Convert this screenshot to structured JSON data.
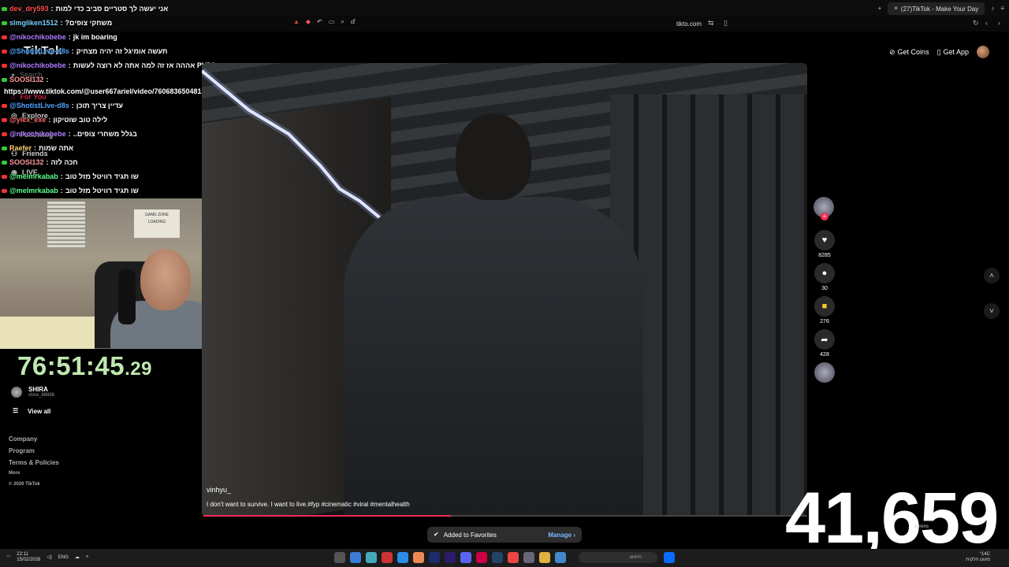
{
  "browser": {
    "tab_title": "(27)TikTok - Make Your Day",
    "domain": "tikto.com"
  },
  "tiktok": {
    "logo": "TikTok",
    "get_coins": "Get Coins",
    "get_app": "Get App",
    "sidebar": {
      "search": "Search",
      "for_you": "For You",
      "explore": "Explore",
      "following": "Following",
      "friends": "Friends",
      "live": "LIVE"
    },
    "profile_name": "SHIRA",
    "profile_handle": "shira_88888",
    "view_all": "View all",
    "footer": [
      "Company",
      "Program",
      "Terms & Policies",
      "More",
      "© 2026 TikTok"
    ],
    "video": {
      "author": "vinhyu_",
      "caption": "I don't want to survive. I want to live.#fyp #cinematic #viral #mentalhealth",
      "progress_fraction": 0.41
    },
    "rail": {
      "likes": "8285",
      "comments": "30",
      "saves": "276",
      "shares": "428"
    },
    "toast": {
      "text": "Added to Favorites",
      "manage": "Manage"
    }
  },
  "chat": [
    {
      "user": "dev_dry593",
      "msg": "אני יעשה לך סטריים סביב כדי למות",
      "color": "#ff4d4d"
    },
    {
      "user": "slmgliken1512",
      "msg": "?משחקי צופים",
      "color": "#7ad0ff"
    },
    {
      "user": "@nikochikobebe",
      "msg": "jk im boaring",
      "color": "#b07cff"
    },
    {
      "user": "@ShotistLive-d8s",
      "msg": "תעשה אומיגל זה יהיה מצחיק",
      "color": "#4fa3ff"
    },
    {
      "user": "@nikochikobebe",
      "msg": "אההה אז זה למה אתה לא רוצה לעשות PVP?",
      "color": "#b07cff"
    },
    {
      "user": "SOOSI132",
      "msg": "",
      "color": "#ff9a9a"
    },
    {
      "user": "",
      "msg": "https://www.tiktok.com/@user667ariel/video/7606836504815937426",
      "color": "#ffffff"
    },
    {
      "user": "@ShotistLive-d8s",
      "msg": "עדיין צריך תוכן",
      "color": "#4fa3ff"
    },
    {
      "user": "@ylex_exe",
      "msg": "לילה טוב שוטיקון",
      "color": "#ff6a6a"
    },
    {
      "user": "@nikochikobebe",
      "msg": "..בגלל משחרי צופים",
      "color": "#b07cff"
    },
    {
      "user": "Raefer",
      "msg": "אתה שמות",
      "color": "#ffd36e"
    },
    {
      "user": "SOOSI132",
      "msg": "חכה לזה",
      "color": "#ff9a9a"
    },
    {
      "user": "@melmrkabab",
      "msg": "שו תגיד רוויטל מזל טוב",
      "color": "#5dff8a"
    },
    {
      "user": "@melmrkabab",
      "msg": "שו תגיד רוויטל מזל טוב",
      "color": "#5dff8a"
    }
  ],
  "webcam": {
    "poster_text": "GAME ZONE",
    "poster_sub": "LOADING"
  },
  "stream": {
    "timer_main": "76:51:45",
    "timer_ms": ".29",
    "counter": "41,659",
    "overlay_name": "korens"
  },
  "taskbar": {
    "time": "22:11",
    "date": "15/02/2026",
    "lang": "ENG",
    "search_placeholder": "חיפוש",
    "weather_line1": "°14C",
    "weather_line2": "מעונן חלקית"
  }
}
